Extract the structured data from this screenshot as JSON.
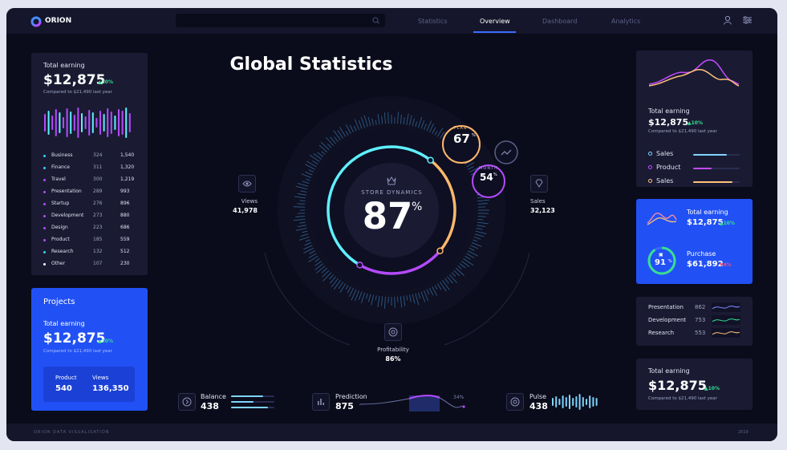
{
  "brand": {
    "name": "ORION"
  },
  "nav": {
    "tabs": [
      "Statistics",
      "Overview",
      "Dashboard",
      "Analytics"
    ],
    "active": "Overview"
  },
  "left_top": {
    "title": "Total earning",
    "value": "$12,875",
    "change": "10%",
    "caption": "Compared to $21,490 last year",
    "rows": [
      {
        "label": "Business",
        "a": "324",
        "b": "1,540",
        "color": "#34d4ff"
      },
      {
        "label": "Finance",
        "a": "311",
        "b": "1,320",
        "color": "#34d4ff"
      },
      {
        "label": "Travel",
        "a": "300",
        "b": "1,219",
        "color": "#b44bff"
      },
      {
        "label": "Presentation",
        "a": "289",
        "b": "993",
        "color": "#b44bff"
      },
      {
        "label": "Startup",
        "a": "276",
        "b": "896",
        "color": "#b44bff"
      },
      {
        "label": "Development",
        "a": "273",
        "b": "880",
        "color": "#b44bff"
      },
      {
        "label": "Design",
        "a": "223",
        "b": "686",
        "color": "#b44bff"
      },
      {
        "label": "Product",
        "a": "185",
        "b": "559",
        "color": "#b44bff"
      },
      {
        "label": "Research",
        "a": "132",
        "b": "512",
        "color": "#34d4ff"
      },
      {
        "label": "Other",
        "a": "107",
        "b": "230",
        "color": "#ffffff"
      }
    ]
  },
  "projects": {
    "title": "Projects",
    "earning_label": "Total earning",
    "value": "$12,875",
    "change": "10%",
    "caption": "Compared to $21,490 last year",
    "product_label": "Product",
    "product_value": "540",
    "views_label": "Views",
    "views_value": "136,350"
  },
  "center": {
    "title": "Global Statistics",
    "store_label": "STORE DYNAMICS",
    "percent": "87",
    "pct_sign": "%",
    "plan_label": "PLAN",
    "plan_value": "67",
    "month_label": "MONTH",
    "month_value": "54",
    "views_label": "Views",
    "views_value": "41,978",
    "sales_label": "Sales",
    "sales_value": "32,123",
    "profit_label": "Profitability",
    "profit_value": "86%"
  },
  "bottom": {
    "balance_label": "Balance",
    "balance_value": "438",
    "prediction_label": "Prediction",
    "prediction_value": "875",
    "prediction_pct": "34%",
    "pulse_label": "Pulse",
    "pulse_value": "438"
  },
  "right1": {
    "title": "Total earning",
    "value": "$12,875",
    "change": "10%",
    "caption": "Compared to $21,490 last year",
    "legend": [
      {
        "label": "Sales",
        "color": "#7fd4ff",
        "level": 0.72
      },
      {
        "label": "Product",
        "color": "#c34bff",
        "level": 0.4
      },
      {
        "label": "Sales",
        "color": "#ffc27a",
        "level": 0.85
      }
    ]
  },
  "right2": {
    "title": "Total earning",
    "value": "$12,875",
    "change": "10%",
    "ring_value": "91",
    "purchase_label": "Purchase",
    "purchase_value": "$61,892",
    "purchase_change": "4%"
  },
  "right3": {
    "rows": [
      {
        "label": "Presentation",
        "value": "862"
      },
      {
        "label": "Development",
        "value": "753"
      },
      {
        "label": "Research",
        "value": "553"
      }
    ]
  },
  "right4": {
    "title": "Total earning",
    "value": "$12,875",
    "change": "10%",
    "caption": "Compared to $21,490 last year"
  },
  "footer": {
    "left": "ORION DATA VISUALISATION",
    "right": "2019"
  },
  "colors": {
    "bg": "#0b0c1b",
    "card": "#1a1b33",
    "blue": "#2151f5",
    "cyan": "#5ef0ff",
    "purple": "#b44bff",
    "orange": "#ffb86b",
    "green": "#38e08f"
  }
}
